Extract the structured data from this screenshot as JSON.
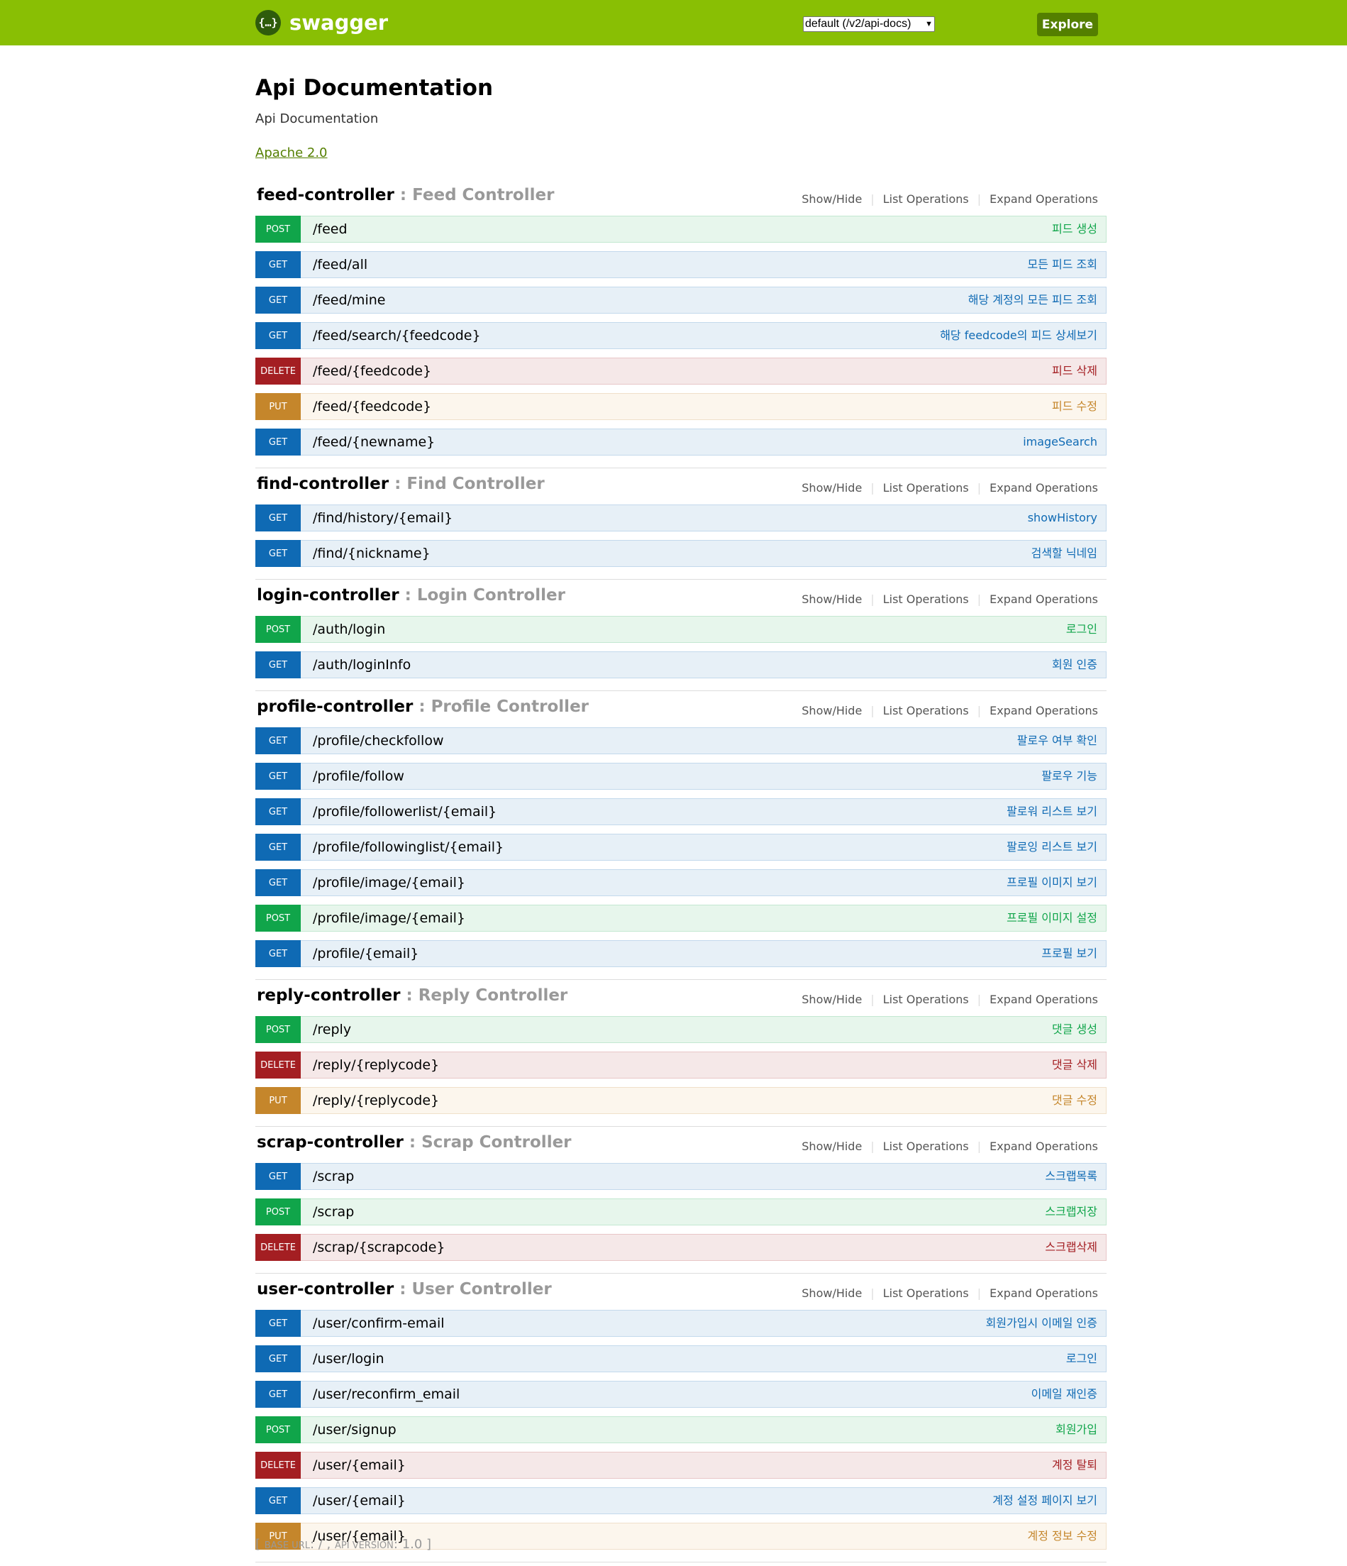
{
  "header": {
    "logo_text": "swagger",
    "spec_select_value": "default (/v2/api-docs)",
    "explore_label": "Explore",
    "brand_color": "#89bf04"
  },
  "info": {
    "title": "Api Documentation",
    "description": "Api Documentation",
    "license": "Apache 2.0"
  },
  "resource_actions": [
    "Show/Hide",
    "List Operations",
    "Expand Operations"
  ],
  "resources": [
    {
      "name": "feed-controller",
      "desc": "Feed Controller",
      "operations": [
        {
          "method": "POST",
          "path": "/feed",
          "summary": "피드 생성"
        },
        {
          "method": "GET",
          "path": "/feed/all",
          "summary": "모든 피드 조회"
        },
        {
          "method": "GET",
          "path": "/feed/mine",
          "summary": "해당 계정의 모든 피드 조회"
        },
        {
          "method": "GET",
          "path": "/feed/search/{feedcode}",
          "summary": "해당 feedcode의 피드 상세보기"
        },
        {
          "method": "DELETE",
          "path": "/feed/{feedcode}",
          "summary": "피드 삭제"
        },
        {
          "method": "PUT",
          "path": "/feed/{feedcode}",
          "summary": "피드 수정"
        },
        {
          "method": "GET",
          "path": "/feed/{newname}",
          "summary": "imageSearch"
        }
      ]
    },
    {
      "name": "find-controller",
      "desc": "Find Controller",
      "operations": [
        {
          "method": "GET",
          "path": "/find/history/{email}",
          "summary": "showHistory"
        },
        {
          "method": "GET",
          "path": "/find/{nickname}",
          "summary": "검색할 닉네임"
        }
      ]
    },
    {
      "name": "login-controller",
      "desc": "Login Controller",
      "operations": [
        {
          "method": "POST",
          "path": "/auth/login",
          "summary": "로그인"
        },
        {
          "method": "GET",
          "path": "/auth/loginInfo",
          "summary": "회원 인증"
        }
      ]
    },
    {
      "name": "profile-controller",
      "desc": "Profile Controller",
      "operations": [
        {
          "method": "GET",
          "path": "/profile/checkfollow",
          "summary": "팔로우 여부 확인"
        },
        {
          "method": "GET",
          "path": "/profile/follow",
          "summary": "팔로우 기능"
        },
        {
          "method": "GET",
          "path": "/profile/followerlist/{email}",
          "summary": "팔로워 리스트 보기"
        },
        {
          "method": "GET",
          "path": "/profile/followinglist/{email}",
          "summary": "팔로잉 리스트 보기"
        },
        {
          "method": "GET",
          "path": "/profile/image/{email}",
          "summary": "프로필 이미지 보기"
        },
        {
          "method": "POST",
          "path": "/profile/image/{email}",
          "summary": "프로필 이미지 설정"
        },
        {
          "method": "GET",
          "path": "/profile/{email}",
          "summary": "프로필 보기"
        }
      ]
    },
    {
      "name": "reply-controller",
      "desc": "Reply Controller",
      "operations": [
        {
          "method": "POST",
          "path": "/reply",
          "summary": "댓글 생성"
        },
        {
          "method": "DELETE",
          "path": "/reply/{replycode}",
          "summary": "댓글 삭제"
        },
        {
          "method": "PUT",
          "path": "/reply/{replycode}",
          "summary": "댓글 수정"
        }
      ]
    },
    {
      "name": "scrap-controller",
      "desc": "Scrap Controller",
      "operations": [
        {
          "method": "GET",
          "path": "/scrap",
          "summary": "스크랩목록"
        },
        {
          "method": "POST",
          "path": "/scrap",
          "summary": "스크랩저장"
        },
        {
          "method": "DELETE",
          "path": "/scrap/{scrapcode}",
          "summary": "스크랩삭제"
        }
      ]
    },
    {
      "name": "user-controller",
      "desc": "User Controller",
      "operations": [
        {
          "method": "GET",
          "path": "/user/confirm-email",
          "summary": "회원가입시 이메일 인증"
        },
        {
          "method": "GET",
          "path": "/user/login",
          "summary": "로그인"
        },
        {
          "method": "GET",
          "path": "/user/reconfirm_email",
          "summary": "이메일 재인증"
        },
        {
          "method": "POST",
          "path": "/user/signup",
          "summary": "회원가입"
        },
        {
          "method": "DELETE",
          "path": "/user/{email}",
          "summary": "계정 탈퇴"
        },
        {
          "method": "GET",
          "path": "/user/{email}",
          "summary": "계정 설정 페이지 보기"
        },
        {
          "method": "PUT",
          "path": "/user/{email}",
          "summary": "계정 정보 수정"
        }
      ]
    }
  ],
  "footer": {
    "base_url_label": "BASE URL",
    "base_url": "/",
    "api_version_label": "API VERSION",
    "api_version": "1.0"
  }
}
